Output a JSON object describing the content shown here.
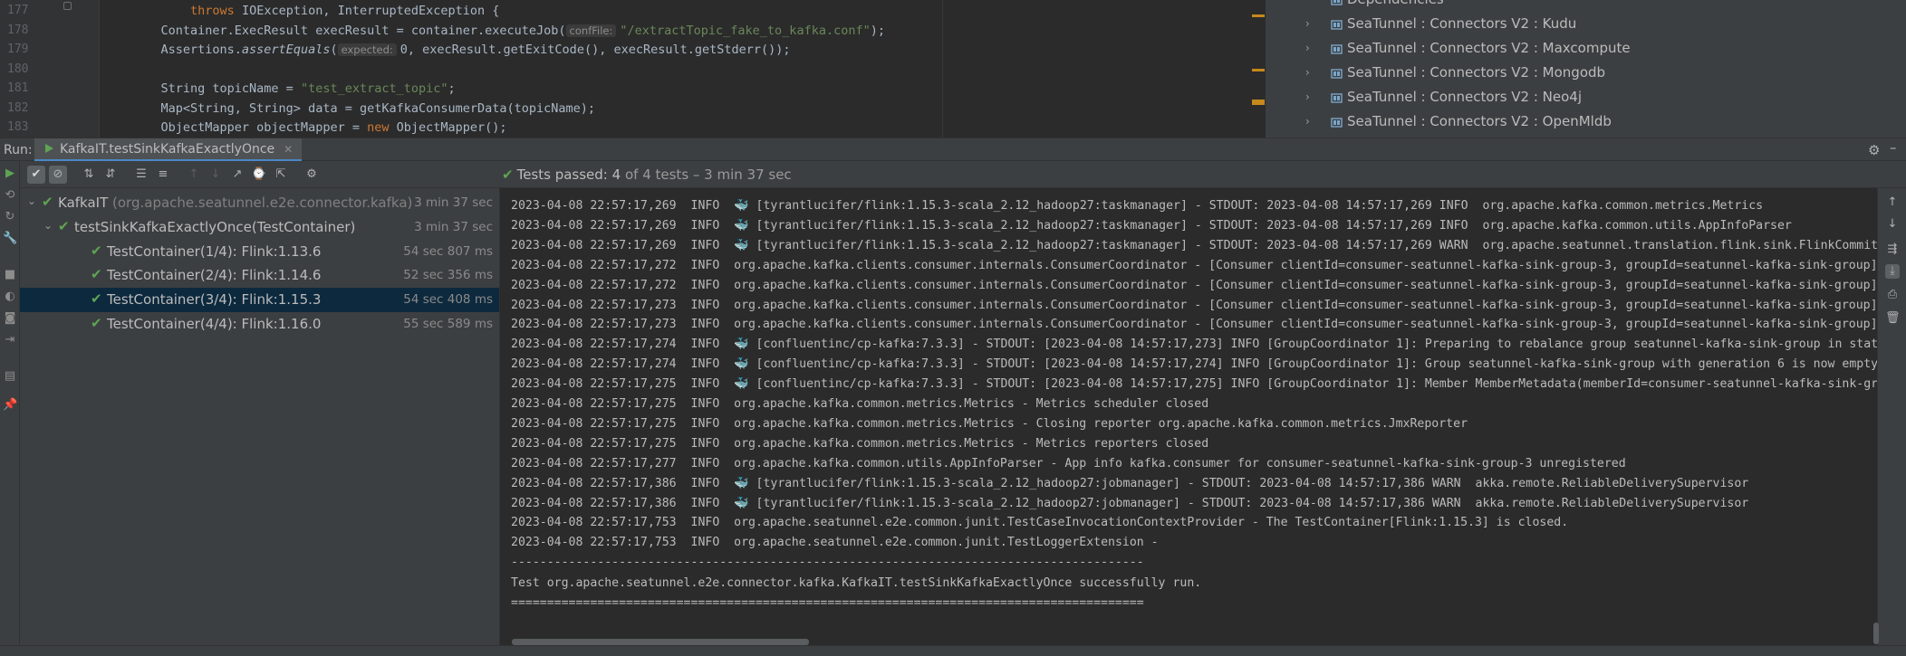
{
  "editor": {
    "lines": [
      {
        "num": "177",
        "segments": [
          {
            "t": "        "
          },
          {
            "t": "throws",
            "c": "kw"
          },
          {
            "t": " IOException, InterruptedException {"
          }
        ]
      },
      {
        "num": "178",
        "segments": [
          {
            "t": "    Container.ExecResult execResult = container.executeJob("
          },
          {
            "t": "confFile:",
            "c": "hint"
          },
          {
            "t": "\"/extractTopic_fake_to_kafka.conf\"",
            "c": "str"
          },
          {
            "t": ");"
          }
        ]
      },
      {
        "num": "179",
        "segments": [
          {
            "t": "    Assertions."
          },
          {
            "t": "assertEquals",
            "c": "it"
          },
          {
            "t": "("
          },
          {
            "t": "expected:",
            "c": "hint"
          },
          {
            "t": "0, execResult.getExitCode(), execResult.getStderr());"
          }
        ]
      },
      {
        "num": "180",
        "segments": [
          {
            "t": ""
          }
        ]
      },
      {
        "num": "181",
        "segments": [
          {
            "t": "    String topicName = "
          },
          {
            "t": "\"test_extract_topic\"",
            "c": "str"
          },
          {
            "t": ";"
          }
        ]
      },
      {
        "num": "182",
        "segments": [
          {
            "t": "    Map<String, String> data = getKafkaConsumerData(topicName);"
          }
        ]
      },
      {
        "num": "183",
        "segments": [
          {
            "t": "    ObjectMapper objectMapper = "
          },
          {
            "t": "new",
            "c": "kw"
          },
          {
            "t": " ObjectMapper();"
          }
        ]
      }
    ]
  },
  "project": {
    "items": [
      {
        "label": "Dependencies"
      },
      {
        "label": "SeaTunnel : Connectors V2 : Kudu"
      },
      {
        "label": "SeaTunnel : Connectors V2 : Maxcompute"
      },
      {
        "label": "SeaTunnel : Connectors V2 : Mongodb"
      },
      {
        "label": "SeaTunnel : Connectors V2 : Neo4j"
      },
      {
        "label": "SeaTunnel : Connectors V2 : OpenMldb"
      }
    ]
  },
  "run": {
    "label": "Run:",
    "tab_title": "KafkaIT.testSinkKafkaExactlyOnce"
  },
  "status": {
    "prefix": "Tests passed:",
    "count": "4",
    "suffix": "of 4 tests – 3 min 37 sec"
  },
  "tests": [
    {
      "name": "KafkaIT",
      "pkg": "(org.apache.seatunnel.e2e.connector.kafka)",
      "duration": "3 min 37 sec",
      "level": 0
    },
    {
      "name": "testSinkKafkaExactlyOnce(TestContainer)",
      "pkg": "",
      "duration": "3 min 37 sec",
      "level": 1
    },
    {
      "name": "TestContainer(1/4): Flink:1.13.6",
      "pkg": "",
      "duration": "54 sec 807 ms",
      "level": 2
    },
    {
      "name": "TestContainer(2/4): Flink:1.14.6",
      "pkg": "",
      "duration": "52 sec 356 ms",
      "level": 2
    },
    {
      "name": "TestContainer(3/4): Flink:1.15.3",
      "pkg": "",
      "duration": "54 sec 408 ms",
      "level": 2,
      "selected": true
    },
    {
      "name": "TestContainer(4/4): Flink:1.16.0",
      "pkg": "",
      "duration": "55 sec 589 ms",
      "level": 2
    }
  ],
  "console": {
    "lines": [
      {
        "ts": "2023-04-08 22:57:17,269",
        "lvl": "INFO",
        "docker": true,
        "msg": "[tyrantlucifer/flink:1.15.3-scala_2.12_hadoop27:taskmanager] - STDOUT: 2023-04-08 14:57:17,269 INFO  org.apache.kafka.common.metrics.Metrics"
      },
      {
        "ts": "2023-04-08 22:57:17,269",
        "lvl": "INFO",
        "docker": true,
        "msg": "[tyrantlucifer/flink:1.15.3-scala_2.12_hadoop27:taskmanager] - STDOUT: 2023-04-08 14:57:17,269 INFO  org.apache.kafka.common.utils.AppInfoParser"
      },
      {
        "ts": "2023-04-08 22:57:17,269",
        "lvl": "INFO",
        "docker": true,
        "msg": "[tyrantlucifer/flink:1.15.3-scala_2.12_hadoop27:taskmanager] - STDOUT: 2023-04-08 14:57:17,269 WARN  org.apache.seatunnel.translation.flink.sink.FlinkCommitt"
      },
      {
        "ts": "2023-04-08 22:57:17,272",
        "lvl": "INFO",
        "docker": false,
        "msg": "org.apache.kafka.clients.consumer.internals.ConsumerCoordinator - [Consumer clientId=consumer-seatunnel-kafka-sink-group-3, groupId=seatunnel-kafka-sink-group]"
      },
      {
        "ts": "2023-04-08 22:57:17,272",
        "lvl": "INFO",
        "docker": false,
        "msg": "org.apache.kafka.clients.consumer.internals.ConsumerCoordinator - [Consumer clientId=consumer-seatunnel-kafka-sink-group-3, groupId=seatunnel-kafka-sink-group]"
      },
      {
        "ts": "2023-04-08 22:57:17,273",
        "lvl": "INFO",
        "docker": false,
        "msg": "org.apache.kafka.clients.consumer.internals.ConsumerCoordinator - [Consumer clientId=consumer-seatunnel-kafka-sink-group-3, groupId=seatunnel-kafka-sink-group]"
      },
      {
        "ts": "2023-04-08 22:57:17,273",
        "lvl": "INFO",
        "docker": false,
        "msg": "org.apache.kafka.clients.consumer.internals.ConsumerCoordinator - [Consumer clientId=consumer-seatunnel-kafka-sink-group-3, groupId=seatunnel-kafka-sink-group]"
      },
      {
        "ts": "2023-04-08 22:57:17,274",
        "lvl": "INFO",
        "docker": true,
        "msg": "[confluentinc/cp-kafka:7.3.3] - STDOUT: [2023-04-08 14:57:17,273] INFO [GroupCoordinator 1]: Preparing to rebalance group seatunnel-kafka-sink-group in state"
      },
      {
        "ts": "2023-04-08 22:57:17,274",
        "lvl": "INFO",
        "docker": true,
        "msg": "[confluentinc/cp-kafka:7.3.3] - STDOUT: [2023-04-08 14:57:17,274] INFO [GroupCoordinator 1]: Group seatunnel-kafka-sink-group with generation 6 is now empty"
      },
      {
        "ts": "2023-04-08 22:57:17,275",
        "lvl": "INFO",
        "docker": true,
        "msg": "[confluentinc/cp-kafka:7.3.3] - STDOUT: [2023-04-08 14:57:17,275] INFO [GroupCoordinator 1]: Member MemberMetadata(memberId=consumer-seatunnel-kafka-sink-grc"
      },
      {
        "ts": "2023-04-08 22:57:17,275",
        "lvl": "INFO",
        "docker": false,
        "msg": "org.apache.kafka.common.metrics.Metrics - Metrics scheduler closed"
      },
      {
        "ts": "2023-04-08 22:57:17,275",
        "lvl": "INFO",
        "docker": false,
        "msg": "org.apache.kafka.common.metrics.Metrics - Closing reporter org.apache.kafka.common.metrics.JmxReporter"
      },
      {
        "ts": "2023-04-08 22:57:17,275",
        "lvl": "INFO",
        "docker": false,
        "msg": "org.apache.kafka.common.metrics.Metrics - Metrics reporters closed"
      },
      {
        "ts": "2023-04-08 22:57:17,277",
        "lvl": "INFO",
        "docker": false,
        "msg": "org.apache.kafka.common.utils.AppInfoParser - App info kafka.consumer for consumer-seatunnel-kafka-sink-group-3 unregistered"
      },
      {
        "ts": "2023-04-08 22:57:17,386",
        "lvl": "INFO",
        "docker": true,
        "msg": "[tyrantlucifer/flink:1.15.3-scala_2.12_hadoop27:jobmanager] - STDOUT: 2023-04-08 14:57:17,386 WARN  akka.remote.ReliableDeliverySupervisor"
      },
      {
        "ts": "2023-04-08 22:57:17,386",
        "lvl": "INFO",
        "docker": true,
        "msg": "[tyrantlucifer/flink:1.15.3-scala_2.12_hadoop27:jobmanager] - STDOUT: 2023-04-08 14:57:17,386 WARN  akka.remote.ReliableDeliverySupervisor"
      },
      {
        "ts": "2023-04-08 22:57:17,753",
        "lvl": "INFO",
        "docker": false,
        "msg": "org.apache.seatunnel.e2e.common.junit.TestCaseInvocationContextProvider - The TestContainer[Flink:1.15.3] is closed."
      },
      {
        "ts": "2023-04-08 22:57:17,753",
        "lvl": "INFO",
        "docker": false,
        "msg": "org.apache.seatunnel.e2e.common.junit.TestLoggerExtension -"
      }
    ],
    "separator_dash": "----------------------------------------------------------------------------------------",
    "result": "Test org.apache.seatunnel.e2e.connector.kafka.KafkaIT.testSinkKafkaExactlyOnce successfully run.",
    "separator_eq": "========================================================================================"
  },
  "colors": {
    "accent": "#4a88c7",
    "pass": "#5fa454",
    "selected_row": "#0d293e",
    "docker": "#3e95d1"
  }
}
